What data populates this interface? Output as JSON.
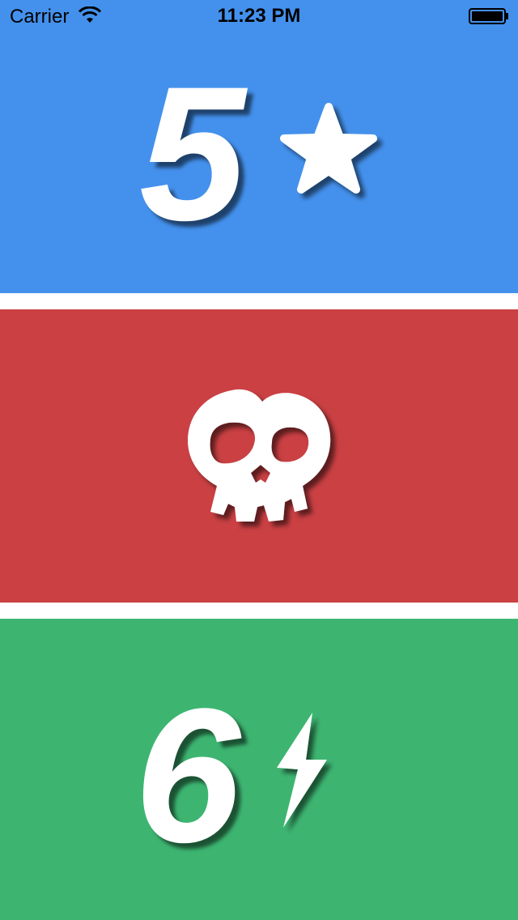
{
  "status_bar": {
    "carrier": "Carrier",
    "time": "11:23 PM",
    "wifi_icon": "wifi-icon",
    "battery_icon": "battery-icon"
  },
  "colors": {
    "blue": "#4491ED",
    "red": "#CA4043",
    "green": "#3DB571",
    "separator": "#FFFFFF",
    "icon": "#FFFFFF"
  },
  "panels": [
    {
      "value": "5",
      "icon": "star-icon"
    },
    {
      "value": "",
      "icon": "skull-icon"
    },
    {
      "value": "6",
      "icon": "lightning-bolt-icon"
    }
  ]
}
